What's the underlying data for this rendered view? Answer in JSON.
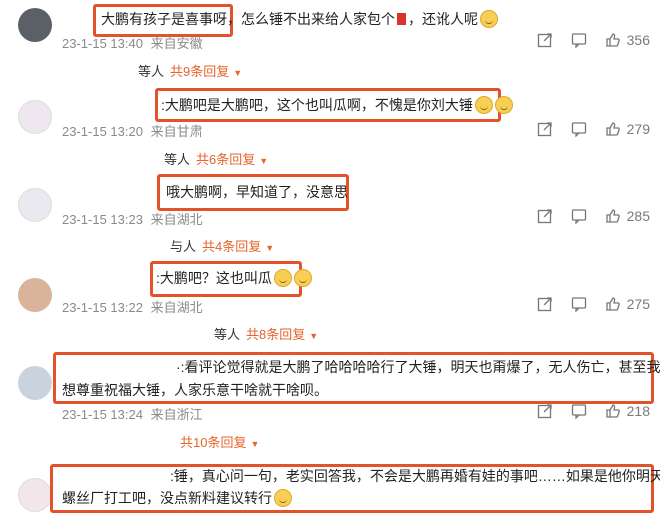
{
  "comments": [
    {
      "text": "大鹏有孩子是喜事呀，怎么锤不出来给人家包个",
      "text_suffix": "，还讹人呢",
      "time": "23-1-15 13:40",
      "location": "来自安徽",
      "likes": "356",
      "reply_prefix": "等人",
      "reply_count": "共9条回复"
    },
    {
      "text": ":大鹏吧是大鹏吧，这个也叫瓜啊，不愧是你刘大锤",
      "time": "23-1-15 13:20",
      "location": "来自甘肃",
      "likes": "279",
      "reply_prefix": "等人",
      "reply_count": "共6条回复"
    },
    {
      "text": "哦大鹏啊，早知道了，没意思",
      "time": "23-1-15 13:23",
      "location": "来自湖北",
      "likes": "285",
      "reply_prefix": "与人",
      "reply_count": "共4条回复"
    },
    {
      "text": ":大鹏吧？这也叫瓜",
      "time": "23-1-15 13:22",
      "location": "来自湖北",
      "likes": "275",
      "reply_prefix": "等人",
      "reply_count": "共8条回复"
    },
    {
      "text_line1": "·:看评论觉得就是大鹏了哈哈哈哈行了大锤，明天也甭爆了，无人伤亡，甚至我还",
      "text_line2": "想尊重祝福大锤，人家乐意干啥就干啥呗。",
      "time": "23-1-15 13:24",
      "location": "来自浙江",
      "likes": "218",
      "reply_prefix": "",
      "reply_count": "共10条回复"
    },
    {
      "text_line1": ":锤，真心问一句，老实回答我，不会是大鹏再婚有娃的事吧……如果是他你明天就去",
      "text_line2": "螺丝厂打工吧，没点新料建议转行"
    }
  ],
  "colors": {
    "highlight": "#e2522b",
    "reply_accent": "#e8632b",
    "meta": "#8a8a8a"
  },
  "icons": [
    "share-icon",
    "comment-icon",
    "like-icon",
    "chevron-down-icon"
  ]
}
